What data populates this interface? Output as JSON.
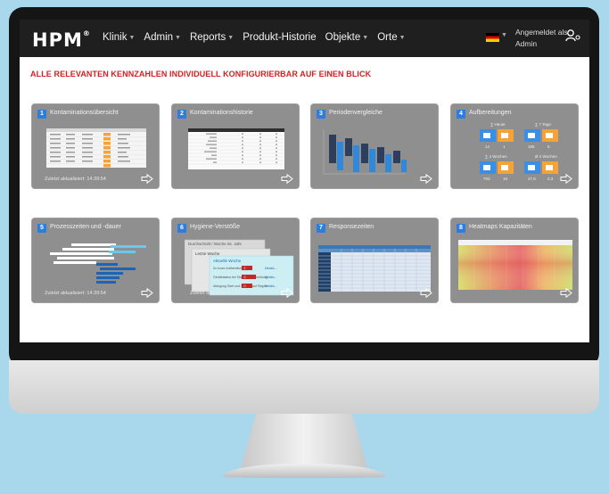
{
  "nav": {
    "logo": "HPM",
    "logo_mark": "®",
    "items": [
      "Klinik",
      "Admin",
      "Reports",
      "Produkt-Historie",
      "Objekte",
      "Orte"
    ],
    "login_label": "Angemeldet als:",
    "login_user": "Admin"
  },
  "headline": "ALLE RELEVANTEN KENNZAHLEN INDIVIDUELL KONFIGURIERBAR AUF EINEN BLICK",
  "tiles": [
    {
      "num": "1",
      "title": "Kontaminationsübersicht",
      "status": "Zuletzt aktualisiert: 14:39:54"
    },
    {
      "num": "2",
      "title": "Kontaminationshistorie",
      "status": ""
    },
    {
      "num": "3",
      "title": "Periodenvergleiche",
      "status": ""
    },
    {
      "num": "4",
      "title": "Aufbereitungen",
      "status": ""
    },
    {
      "num": "5",
      "title": "Prozesszeiten und -dauer",
      "status": "Zuletzt aktualisiert: 14:39:54"
    },
    {
      "num": "6",
      "title": "Hygiene-Verstöße",
      "status": "Zuletzt aktualisiert: 14:39:54"
    },
    {
      "num": "7",
      "title": "Responsezeiten",
      "status": ""
    },
    {
      "num": "8",
      "title": "Heatmaps Kapazitäten",
      "status": ""
    }
  ],
  "aufbereitungen": {
    "label_today": "∑ Heute",
    "label_7days": "∑ 7 Tage",
    "label_4weeks": "∑ 4 Wochen",
    "label_avg4weeks": "Ø 4 Wochen",
    "today_values": [
      "14",
      "1"
    ],
    "days7_values": [
      "185",
      "5"
    ],
    "weeks4_values": [
      "703",
      "18"
    ],
    "avg_values": [
      "27,9",
      "0,3"
    ]
  },
  "hygiene": {
    "back_title": "Durchschnitt / Woche int. Jahr",
    "mid_title": "Letzte Woche",
    "front_title": "Aktuelle Woche",
    "rows": [
      {
        "label": "Zu kurze Aufbereitung",
        "value": "2",
        "link": "Details..."
      },
      {
        "label": "Gerätestatus bei Start der Aufbereitung",
        "value": "3",
        "link": "Details..."
      },
      {
        "label": "Ablegung Start und Weiter-Lauf Regeln",
        "value": "0",
        "link": "Details..."
      }
    ]
  },
  "colors": {
    "tile_bg": "#8f8f8f",
    "badge": "#2b7de0",
    "headline": "#d42020",
    "navbar": "#1f1f1f",
    "background": "#a9d8ec"
  }
}
